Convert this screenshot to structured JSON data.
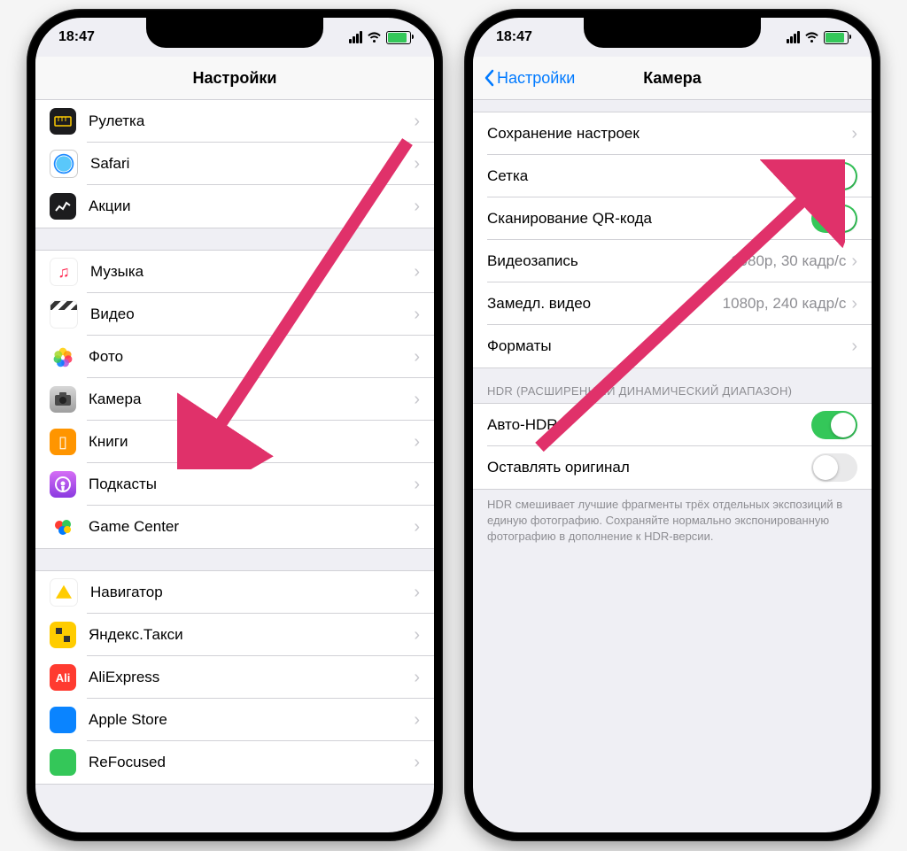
{
  "status": {
    "time": "18:47"
  },
  "left": {
    "title": "Настройки",
    "groups": [
      [
        {
          "icon": "ic-ruler",
          "name": "ruletka",
          "label": "Рулетка"
        },
        {
          "icon": "ic-safari",
          "name": "safari",
          "label": "Safari"
        },
        {
          "icon": "ic-stocks",
          "name": "stocks",
          "label": "Акции"
        }
      ],
      [
        {
          "icon": "ic-music",
          "name": "music",
          "label": "Музыка"
        },
        {
          "icon": "ic-video",
          "name": "video",
          "label": "Видео"
        },
        {
          "icon": "ic-photos",
          "name": "photos",
          "label": "Фото"
        },
        {
          "icon": "ic-camera",
          "name": "camera",
          "label": "Камера"
        },
        {
          "icon": "ic-books",
          "name": "books",
          "label": "Книги"
        },
        {
          "icon": "ic-podcasts",
          "name": "podcasts",
          "label": "Подкасты"
        },
        {
          "icon": "ic-gc",
          "name": "game-center",
          "label": "Game Center"
        }
      ],
      [
        {
          "icon": "ic-nav",
          "name": "navigator",
          "label": "Навигатор"
        },
        {
          "icon": "ic-taxi",
          "name": "yandex-taxi",
          "label": "Яндекс.Такси"
        },
        {
          "icon": "ic-ali",
          "name": "aliexpress",
          "label": "AliExpress"
        },
        {
          "icon": "ic-apple",
          "name": "apple-store",
          "label": "Apple Store"
        },
        {
          "icon": "ic-ref",
          "name": "refocused",
          "label": "ReFocused"
        }
      ]
    ]
  },
  "right": {
    "back": "Настройки",
    "title": "Камера",
    "rows": {
      "preserve": "Сохранение настроек",
      "grid": "Сетка",
      "qr": "Сканирование QR-кода",
      "video": "Видеозапись",
      "video_val": "1080p, 30 кадр/с",
      "slomo": "Замедл. видео",
      "slomo_val": "1080p, 240 кадр/с",
      "formats": "Форматы"
    },
    "hdr_header": "HDR (РАСШИРЕННЫЙ ДИНАМИЧЕСКИЙ ДИАПАЗОН)",
    "auto_hdr": "Авто-HDR",
    "keep_orig": "Оставлять оригинал",
    "hdr_footer": "HDR смешивает лучшие фрагменты трёх отдельных экспозиций в единую фотографию. Сохраняйте нормально экспонированную фотографию в дополнение к HDR-версии."
  }
}
